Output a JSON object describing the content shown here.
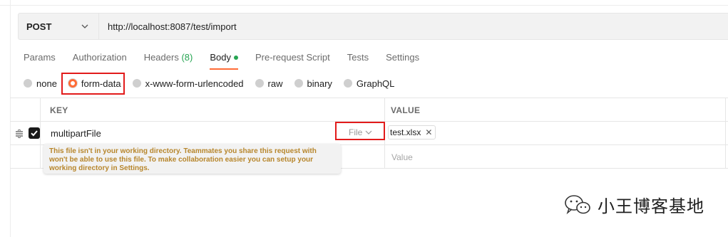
{
  "request": {
    "method": "POST",
    "url": "http://localhost:8087/test/import"
  },
  "tabs": [
    {
      "label": "Params"
    },
    {
      "label": "Authorization"
    },
    {
      "label": "Headers",
      "count": "(8)"
    },
    {
      "label": "Body"
    },
    {
      "label": "Pre-request Script"
    },
    {
      "label": "Tests"
    },
    {
      "label": "Settings"
    }
  ],
  "body_types": [
    {
      "label": "none"
    },
    {
      "label": "form-data"
    },
    {
      "label": "x-www-form-urlencoded"
    },
    {
      "label": "raw"
    },
    {
      "label": "binary"
    },
    {
      "label": "GraphQL"
    }
  ],
  "table": {
    "key_header": "KEY",
    "value_header": "VALUE",
    "row": {
      "key": "multipartFile",
      "type": "File",
      "file": "test.xlsx"
    },
    "empty_row": {
      "value_placeholder": "Value"
    }
  },
  "tooltip": {
    "text": "This file isn't in your working directory. Teammates you share this request with won't be able to use this file. To make collaboration easier you can setup your working directory in Settings."
  },
  "watermark": {
    "text": "小王博客基地"
  },
  "colors": {
    "accent": "#ff6c37",
    "highlight": "#e21b1b",
    "count_green": "#26a552",
    "tooltip_text": "#b7862c"
  }
}
